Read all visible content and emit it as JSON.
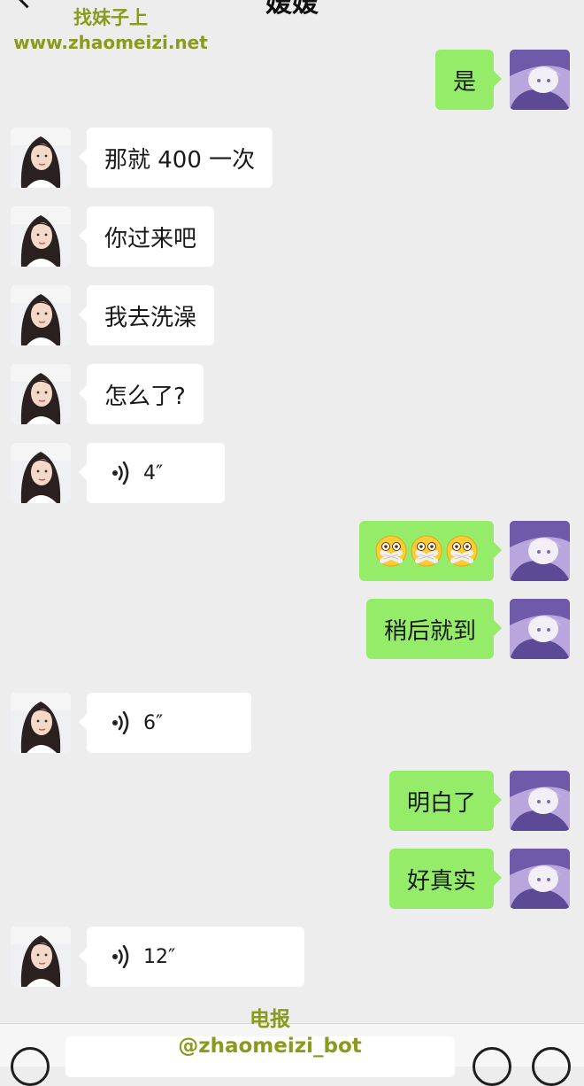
{
  "header": {
    "title": "嫒嫒",
    "back_icon": "chevron-left-icon"
  },
  "watermark": {
    "top_line1": "找妹子上",
    "top_line2": "www.zhaomeizi.net",
    "bottom_line1": "电报",
    "bottom_line2": "@zhaomeizi_bot"
  },
  "colors": {
    "background": "#ededed",
    "incoming_bubble": "#ffffff",
    "outgoing_bubble": "#95ec69",
    "watermark": "#8a9a1c"
  },
  "messages": [
    {
      "from": "me",
      "text": "是"
    },
    {
      "from": "contact",
      "text": "那就 400 一次"
    },
    {
      "from": "contact",
      "text": "你过来吧"
    },
    {
      "from": "contact",
      "text": "我去洗澡"
    },
    {
      "from": "contact",
      "text": "怎么了?"
    },
    {
      "from": "contact",
      "type": "voice",
      "duration": "4″"
    },
    {
      "from": "me",
      "type": "emoji",
      "emoji": [
        "zipper-mouth-face",
        "zipper-mouth-face",
        "zipper-mouth-face"
      ]
    },
    {
      "from": "me",
      "text": "稍后就到"
    },
    {
      "from": "contact",
      "type": "voice",
      "duration": "6″"
    },
    {
      "from": "me",
      "text": "明白了"
    },
    {
      "from": "me",
      "text": "好真实"
    },
    {
      "from": "contact",
      "type": "voice",
      "duration": "12″"
    }
  ],
  "input_bar": {
    "voice_icon": "voice-input-icon",
    "emoji_icon": "smiley-icon",
    "plus_icon": "plus-icon"
  }
}
